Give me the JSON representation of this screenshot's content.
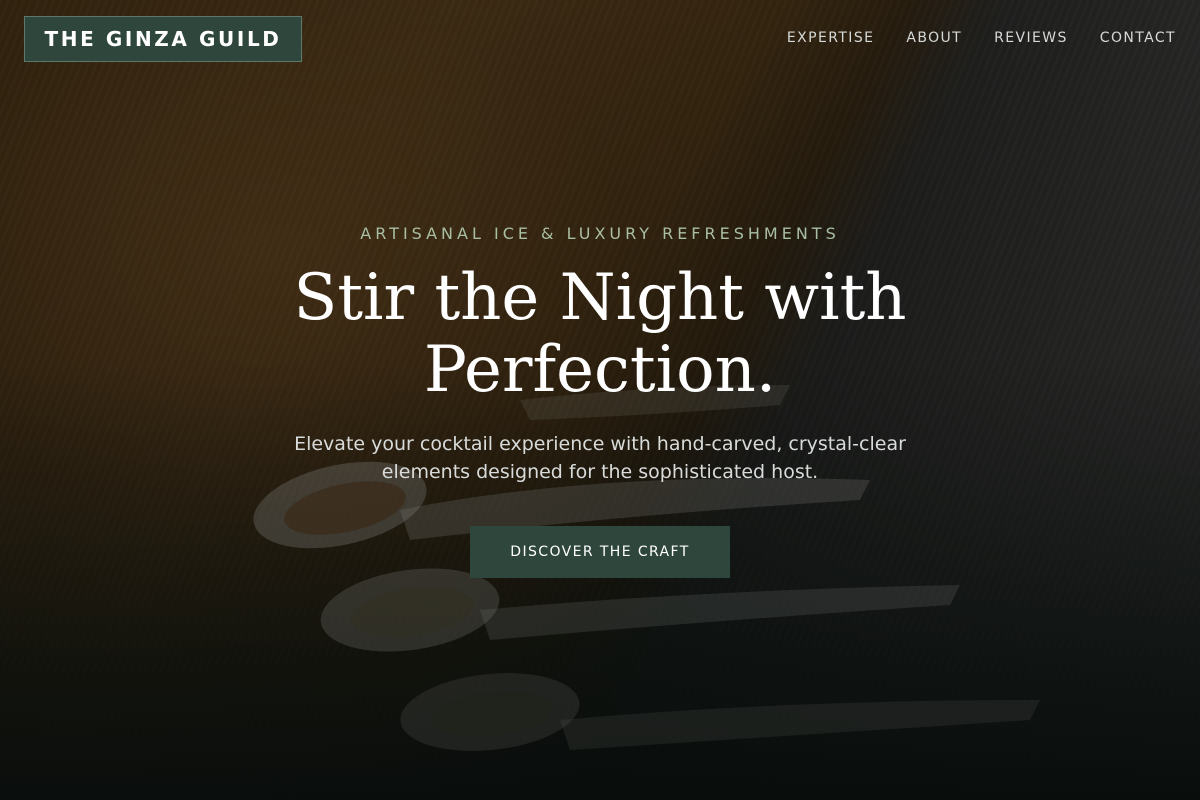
{
  "brand": {
    "name": "THE GINZA GUILD"
  },
  "nav": {
    "items": [
      {
        "label": "EXPERTISE"
      },
      {
        "label": "ABOUT"
      },
      {
        "label": "REVIEWS"
      },
      {
        "label": "CONTACT"
      }
    ]
  },
  "hero": {
    "eyebrow": "ARTISANAL ICE & LUXURY REFRESHMENTS",
    "headline": "Stir the Night with Perfection.",
    "subheadline": "Elevate your cocktail experience with hand-carved, crystal-clear elements designed for the sophisticated host.",
    "cta_label": "DISCOVER THE CRAFT"
  },
  "colors": {
    "accent_green": "#2e463c",
    "eyebrow_green": "#a9bfa4",
    "nav_text": "#d6d9d7"
  }
}
